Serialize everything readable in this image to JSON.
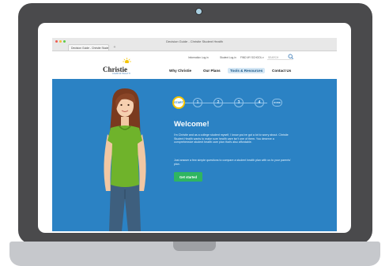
{
  "browser": {
    "window_title": "Decision Guide - Christie Student Health",
    "tab_label": "Decision Guide - Christie Stude...",
    "new_tab_glyph": "+"
  },
  "site": {
    "logo_text": "Christie",
    "logo_subtext": "CAMPUS HEALTH",
    "utility_links": [
      "Information Log-in",
      "Student Log-in",
      "FIND MY SCHOOL ▾"
    ],
    "search_placeholder": "SEARCH",
    "nav": [
      "Why Christie",
      "Our Plans",
      "Tools & Resources",
      "Contact Us"
    ],
    "active_nav": "Tools & Resources"
  },
  "wizard": {
    "steps": [
      "START",
      "1",
      "2",
      "3",
      "4",
      "DONE"
    ],
    "current_step": "START",
    "title": "Welcome!",
    "intro": "I'm Christie and as a college student myself, I know you've got a lot to worry about. Christie Student Health wants to make sure health care isn't one of them. You deserve a comprehensive student health care plan that's also affordable.",
    "instruction": "Just answer a few simple questions to compare a student health plan with us to your parents' plan.",
    "button_label": "Get started"
  },
  "colors": {
    "hero_blue": "#2b82c4",
    "button_green": "#2fb561",
    "start_ring": "#f5c400",
    "laptop_frame": "#4a4a4c"
  },
  "icons": [
    "camera-icon",
    "search-icon",
    "sun-logo-icon"
  ]
}
